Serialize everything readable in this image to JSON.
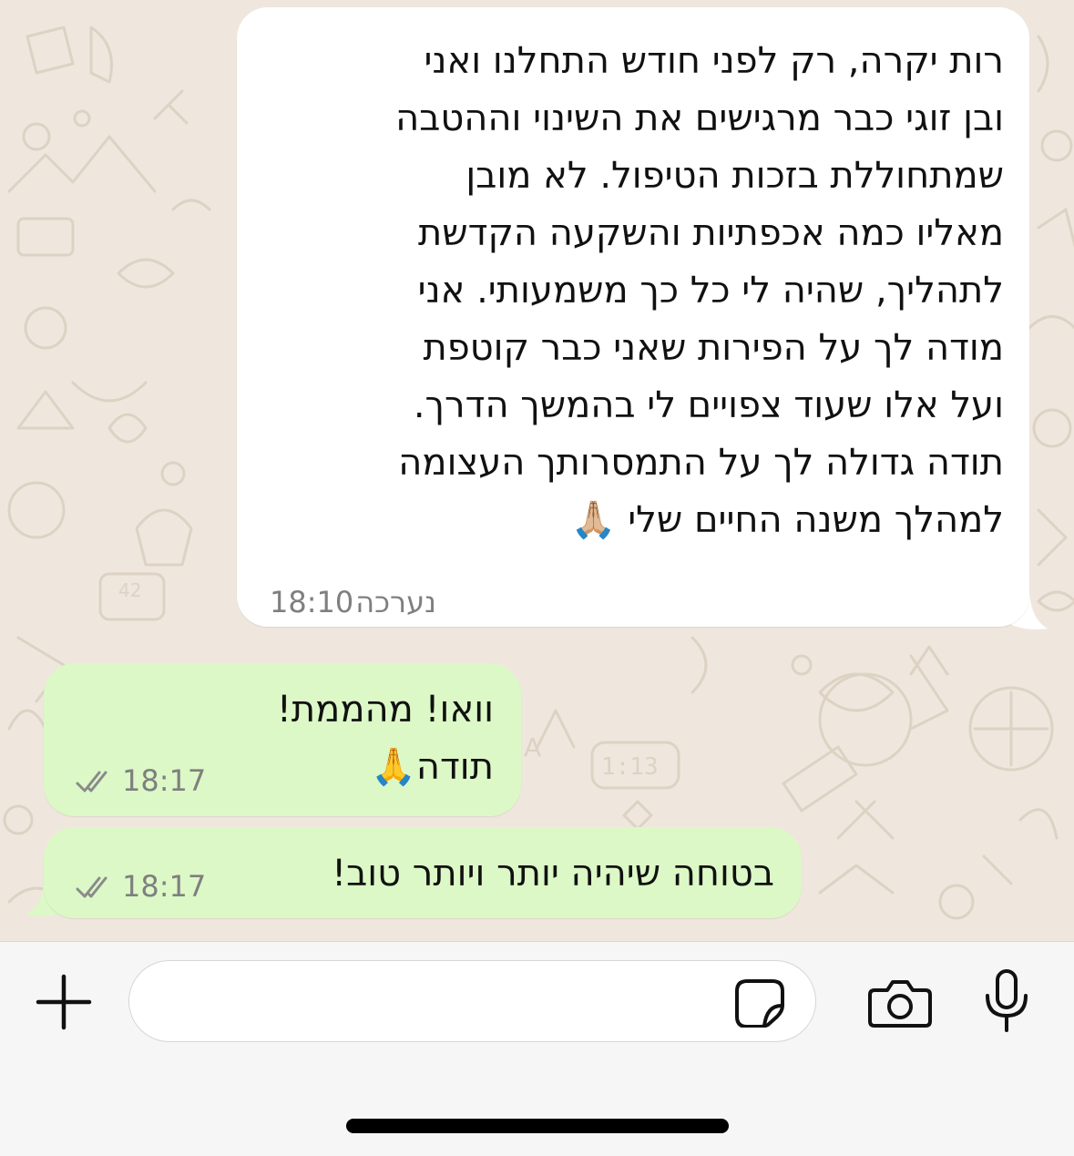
{
  "messages": [
    {
      "direction": "incoming",
      "text": "רות יקרה, רק לפני חודש התחלנו ואני\nובן זוגי כבר מרגישים את השינוי וההטבה\nשמתחוללת בזכות הטיפול. לא מובן\nמאליו כמה אכפתיות והשקעה הקדשת\nלתהליך, שהיה לי כל כך משמעותי. אני\nמודה לך על הפירות שאני כבר קוטפת\nועל אלו שעוד צפויים לי בהמשך הדרך.\nתודה גדולה לך על התמסרותך העצומה\nלמהלך משנה החיים שלי 🙏🏼",
      "edited_label": "נערכה",
      "time": "18:10"
    },
    {
      "direction": "outgoing",
      "text": "וואו! מהממת!\nתודה🙏",
      "time": "18:17",
      "status_icon": "double-check-icon"
    },
    {
      "direction": "outgoing",
      "text": "בטוחה שיהיה יותר ויותר טוב!",
      "time": "18:17",
      "status_icon": "double-check-icon"
    }
  ],
  "input_bar": {
    "placeholder": "",
    "icons": [
      "plus-icon",
      "sticker-icon",
      "camera-icon",
      "microphone-icon"
    ]
  },
  "colors": {
    "chat_background": "#efe7dd",
    "incoming_bubble": "#ffffff",
    "outgoing_bubble": "#dcf8c6",
    "input_bar": "#f6f6f6"
  }
}
